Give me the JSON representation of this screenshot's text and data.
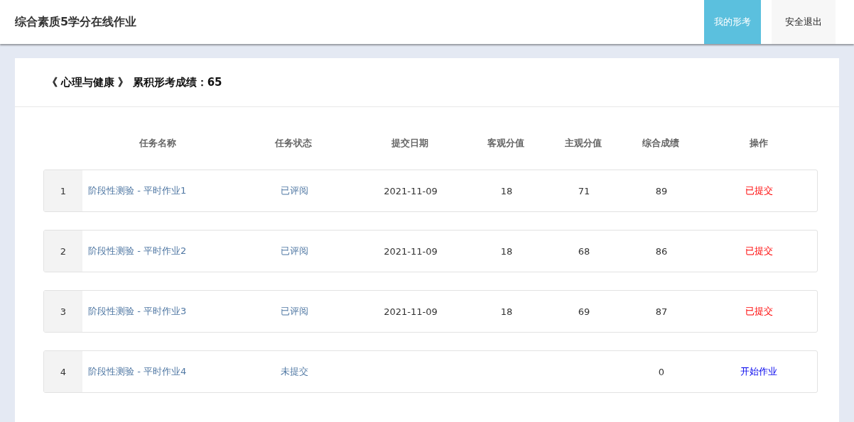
{
  "app_title": "综合素质5学分在线作业",
  "nav": [
    {
      "label": "我的形考",
      "selected": true
    },
    {
      "label": "安全退出",
      "selected": false
    }
  ],
  "course_heading": "《 心理与健康 》 累积形考成绩：65",
  "table": {
    "columns": [
      "任务名称",
      "任务状态",
      "提交日期",
      "客观分值",
      "主观分值",
      "综合成绩",
      "操作"
    ],
    "rows": [
      {
        "index": "1",
        "name": "阶段性测验 - 平时作业1",
        "status": "已评阅",
        "date": "2021-11-09",
        "objective": "18",
        "subjective": "71",
        "total": "89",
        "action": {
          "kind": "submitted",
          "label": "已提交"
        }
      },
      {
        "index": "2",
        "name": "阶段性测验 - 平时作业2",
        "status": "已评阅",
        "date": "2021-11-09",
        "objective": "18",
        "subjective": "68",
        "total": "86",
        "action": {
          "kind": "submitted",
          "label": "已提交"
        }
      },
      {
        "index": "3",
        "name": "阶段性测验 - 平时作业3",
        "status": "已评阅",
        "date": "2021-11-09",
        "objective": "18",
        "subjective": "69",
        "total": "87",
        "action": {
          "kind": "submitted",
          "label": "已提交"
        }
      },
      {
        "index": "4",
        "name": "阶段性测验 - 平时作业4",
        "status": "未提交",
        "total": "0",
        "action": {
          "kind": "start",
          "label": "开始作业"
        }
      }
    ]
  }
}
